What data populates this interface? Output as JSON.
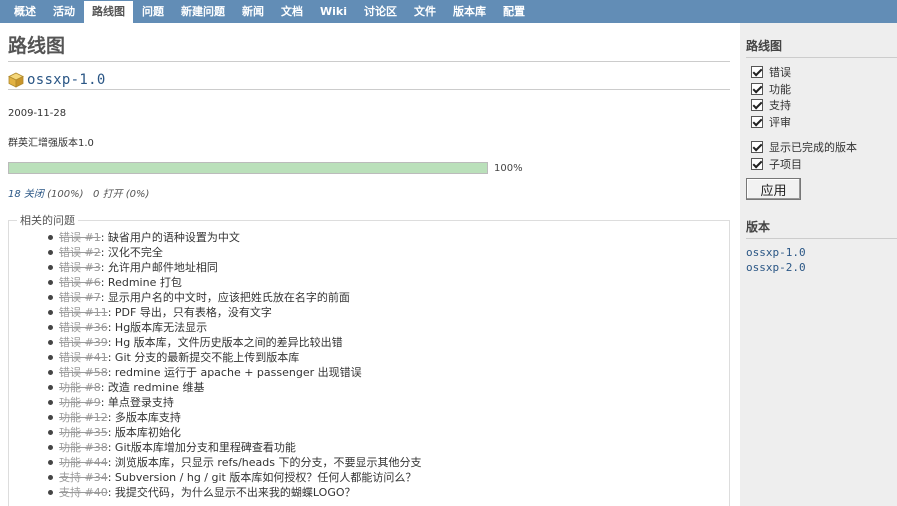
{
  "menu": [
    {
      "label": "概述",
      "selected": false
    },
    {
      "label": "活动",
      "selected": false
    },
    {
      "label": "路线图",
      "selected": true
    },
    {
      "label": "问题",
      "selected": false
    },
    {
      "label": "新建问题",
      "selected": false
    },
    {
      "label": "新闻",
      "selected": false
    },
    {
      "label": "文档",
      "selected": false
    },
    {
      "label": "Wiki",
      "selected": false
    },
    {
      "label": "讨论区",
      "selected": false
    },
    {
      "label": "文件",
      "selected": false
    },
    {
      "label": "版本库",
      "selected": false
    },
    {
      "label": "配置",
      "selected": false
    }
  ],
  "page": {
    "title": "路线图",
    "version_name": "ossxp-1.0",
    "date": "2009-11-28",
    "description": "群英汇增强版本1.0",
    "progress_percent": 100,
    "percent_label": "100%",
    "closed_label": "18 关闭",
    "closed_pct": "(100%)",
    "open_label": "0 打开 (0%)"
  },
  "related": {
    "legend": "相关的问题",
    "issues": [
      {
        "ref": "错误 #1",
        "subject": ": 缺省用户的语种设置为中文"
      },
      {
        "ref": "错误 #2",
        "subject": ": 汉化不完全"
      },
      {
        "ref": "错误 #3",
        "subject": ": 允许用户邮件地址相同"
      },
      {
        "ref": "错误 #6",
        "subject": ": Redmine 打包"
      },
      {
        "ref": "错误 #7",
        "subject": ": 显示用户名的中文时，应该把姓氏放在名字的前面"
      },
      {
        "ref": "错误 #11",
        "subject": ": PDF 导出，只有表格，没有文字"
      },
      {
        "ref": "错误 #36",
        "subject": ": Hg版本库无法显示"
      },
      {
        "ref": "错误 #39",
        "subject": ": Hg 版本库，文件历史版本之间的差异比较出错"
      },
      {
        "ref": "错误 #41",
        "subject": ": Git 分支的最新提交不能上传到版本库"
      },
      {
        "ref": "错误 #58",
        "subject": ": redmine 运行于 apache + passenger 出现错误"
      },
      {
        "ref": "功能 #8",
        "subject": ": 改造 redmine 维基"
      },
      {
        "ref": "功能 #9",
        "subject": ": 单点登录支持"
      },
      {
        "ref": "功能 #12",
        "subject": ": 多版本库支持"
      },
      {
        "ref": "功能 #35",
        "subject": ": 版本库初始化"
      },
      {
        "ref": "功能 #38",
        "subject": ": Git版本库增加分支和里程碑查看功能"
      },
      {
        "ref": "功能 #44",
        "subject": ": 浏览版本库，只显示 refs/heads 下的分支，不要显示其他分支"
      },
      {
        "ref": "支持 #34",
        "subject": ": Subversion / hg / git 版本库如何授权？任何人都能访问么？"
      },
      {
        "ref": "支持 #40",
        "subject": ": 我提交代码，为什么显示不出来我的蝴蝶LOGO？"
      }
    ]
  },
  "sidebar": {
    "title": "路线图",
    "trackers": [
      "错误",
      "功能",
      "支持",
      "评审"
    ],
    "options": [
      "显示已完成的版本",
      "子项目"
    ],
    "apply_label": "应用",
    "versions_title": "版本",
    "versions": [
      "ossxp-1.0",
      "ossxp-2.0"
    ]
  },
  "colors": {
    "menu_bg": "#628db6",
    "progress_done": "#bae0ba",
    "link": "#2a5685",
    "sidebar_bg": "#eeeeee"
  },
  "icons": {
    "version": "package-icon"
  }
}
